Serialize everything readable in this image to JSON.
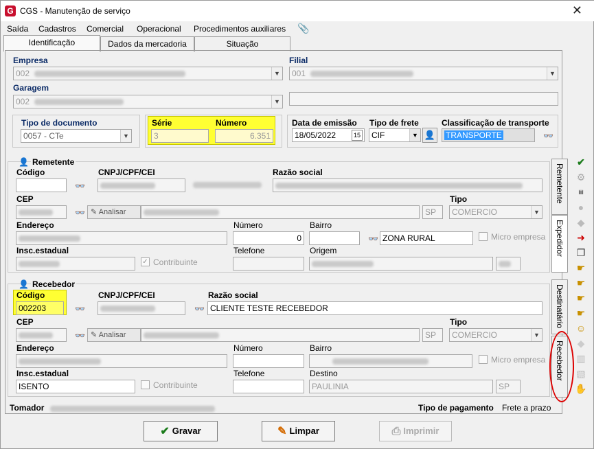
{
  "window": {
    "title": "CGS - Manutenção de serviço",
    "app_icon_letter": "G",
    "close_symbol": "✕"
  },
  "menu": {
    "items": [
      "Saída",
      "Cadastros",
      "Comercial",
      "Operacional",
      "Procedimentos auxiliares"
    ]
  },
  "tabs": {
    "identificacao": "Identificação",
    "dados_mercadoria": "Dados da mercadoria",
    "situacao": "Situação"
  },
  "header": {
    "empresa_label": "Empresa",
    "empresa_code": "002",
    "filial_label": "Filial",
    "filial_code": "001",
    "garagem_label": "Garagem",
    "garagem_code": "002",
    "tipo_documento_label": "Tipo de documento",
    "tipo_documento_value": "0057 - CTe",
    "serie_label": "Série",
    "serie_value": "3",
    "numero_label": "Número",
    "numero_value": "6.351",
    "data_emissao_label": "Data de emissão",
    "data_emissao_value": "18/05/2022",
    "calendar_day": "15",
    "tipo_frete_label": "Tipo de frete",
    "tipo_frete_value": "CIF",
    "classificacao_label": "Classificação de transporte",
    "classificacao_value": "TRANSPORTE"
  },
  "remetente": {
    "title": "Remetente",
    "codigo_label": "Código",
    "cnpj_label": "CNPJ/CPF/CEI",
    "razao_label": "Razão social",
    "cep_label": "CEP",
    "analisar_label": "Analisar",
    "uf_value": "SP",
    "tipo_label": "Tipo",
    "tipo_value": "COMERCIO",
    "endereco_label": "Endereço",
    "numero_label": "Número",
    "numero_value": "0",
    "bairro_label": "Bairro",
    "bairro_value": "ZONA RURAL",
    "micro_empresa_label": "Micro empresa",
    "insc_label": "Insc.estadual",
    "contribuinte_label": "Contribuinte",
    "telefone_label": "Telefone",
    "origem_label": "Origem"
  },
  "recebedor": {
    "title": "Recebedor",
    "codigo_label": "Código",
    "codigo_value": "002203",
    "cnpj_label": "CNPJ/CPF/CEI",
    "razao_label": "Razão social",
    "razao_value": "CLIENTE TESTE RECEBEDOR",
    "cep_label": "CEP",
    "analisar_label": "Analisar",
    "uf_value": "SP",
    "tipo_label": "Tipo",
    "tipo_value": "COMERCIO",
    "endereco_label": "Endereço",
    "numero_label": "Número",
    "bairro_label": "Bairro",
    "micro_empresa_label": "Micro empresa",
    "insc_label": "Insc.estadual",
    "insc_value": "ISENTO",
    "contribuinte_label": "Contribuinte",
    "telefone_label": "Telefone",
    "destino_label": "Destino",
    "destino_value": "PAULINIA",
    "destino_uf": "SP"
  },
  "side_tabs": {
    "remetente": "Remetente",
    "expedidor": "Expedidor",
    "destinatario": "Destinatário",
    "recebedor": "Recebedor"
  },
  "footer": {
    "tomador_label": "Tomador",
    "tipo_pagamento_label": "Tipo de pagamento",
    "tipo_pagamento_value": "Frete a prazo"
  },
  "buttons": {
    "gravar": "Gravar",
    "limpar": "Limpar",
    "imprimir": "Imprimir"
  },
  "icons": [
    "paperclip-icon",
    "binoculars-icon",
    "calendar-icon",
    "person-search-icon",
    "checkmark-icon",
    "eraser-icon",
    "printer-icon"
  ],
  "colors": {
    "highlight": "#ffff33",
    "annotation": "#dd0000",
    "label_blue": "#0a2a66",
    "selection": "#3399ff"
  }
}
